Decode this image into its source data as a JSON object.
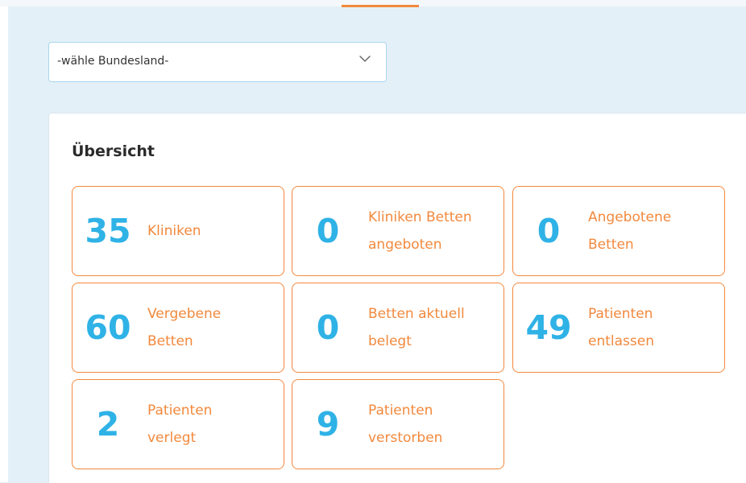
{
  "header": {
    "active_tab_color": "#f2893d"
  },
  "filter": {
    "select_value": "-wähle Bundesland-",
    "icon": "chevron-down-icon"
  },
  "overview": {
    "title": "Übersicht",
    "accent_color": "#f2893d",
    "number_color": "#2fb2e6",
    "stats": [
      {
        "value": "35",
        "label": "Kliniken"
      },
      {
        "value": "0",
        "label": "Kliniken Betten angeboten"
      },
      {
        "value": "0",
        "label": "Angebotene Betten"
      },
      {
        "value": "60",
        "label": "Vergebene Betten"
      },
      {
        "value": "0",
        "label": "Betten aktuell belegt"
      },
      {
        "value": "49",
        "label": "Patienten entlassen"
      },
      {
        "value": "2",
        "label": "Patienten verlegt"
      },
      {
        "value": "9",
        "label": "Patienten verstorben"
      }
    ]
  }
}
